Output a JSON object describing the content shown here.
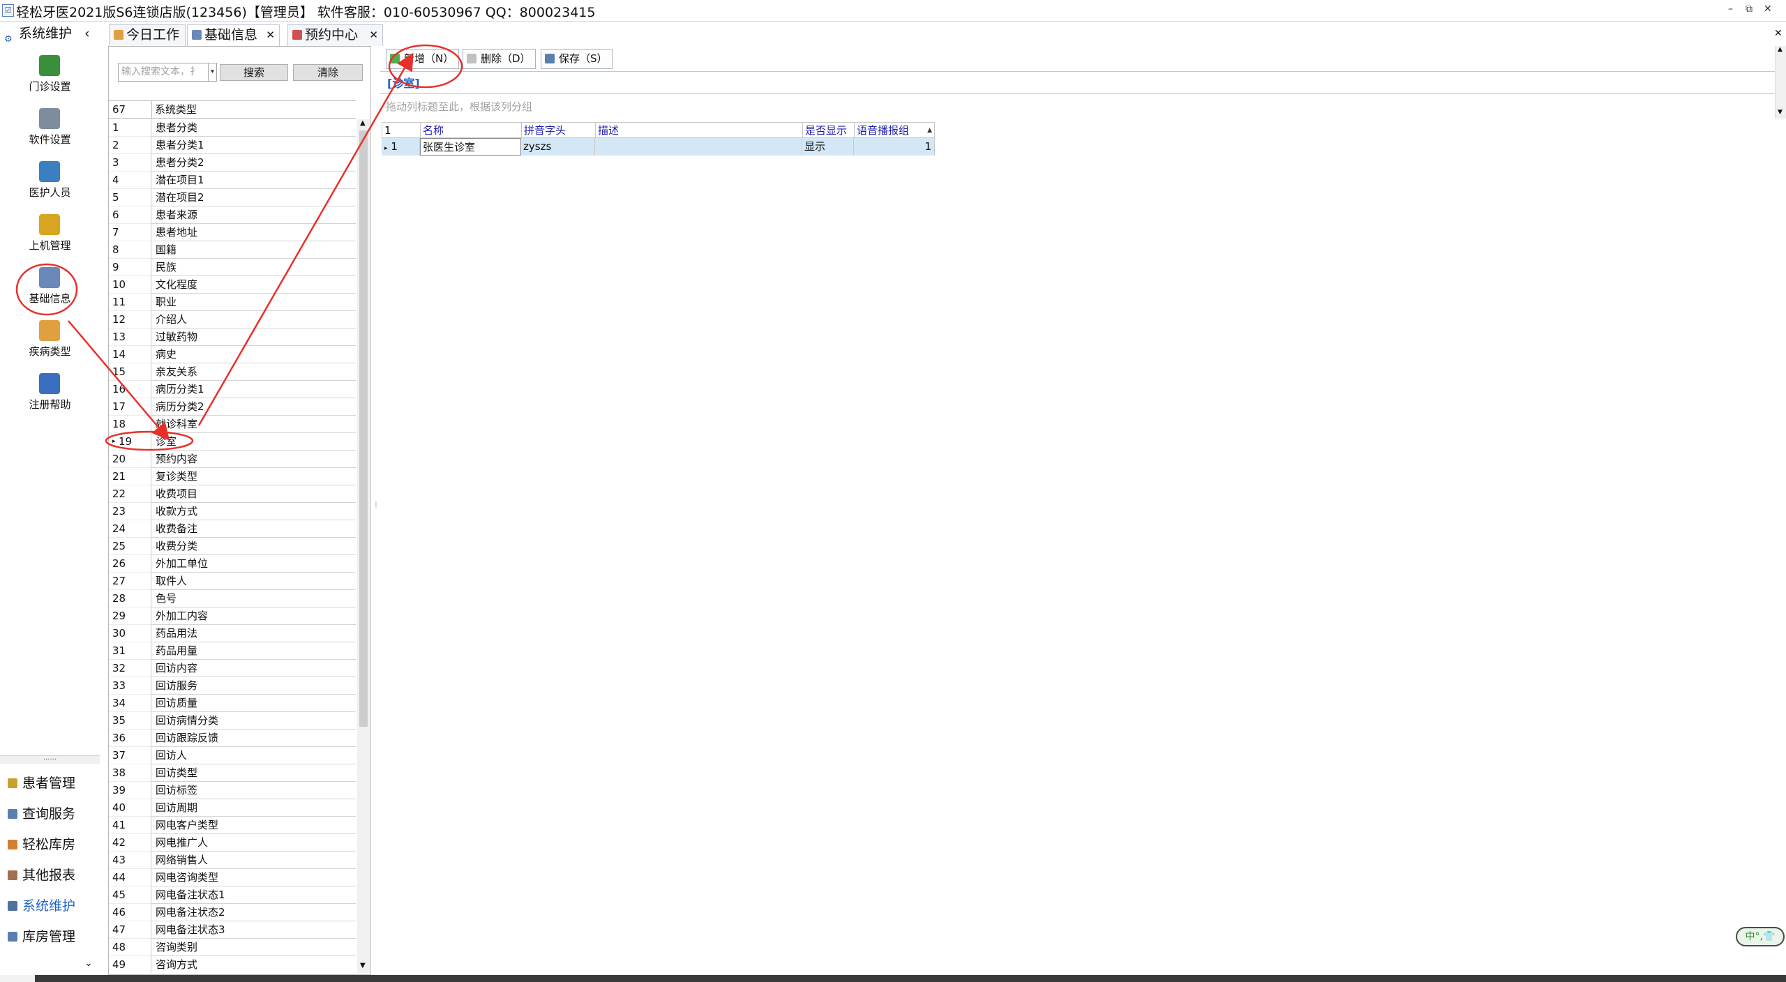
{
  "window": {
    "title": "轻松牙医2021版S6连锁店版(123456)【管理员】   软件客服：010-60530967 QQ：800023415",
    "icon": "☑",
    "controls": [
      "–",
      "⧉",
      "✕"
    ]
  },
  "tabs": [
    {
      "label": "今日工作",
      "icon": "person-icon",
      "color": "#e0a040"
    },
    {
      "label": "基础信息",
      "icon": "info-icon",
      "color": "#6a88b8",
      "close": "✕"
    },
    {
      "label": "预约中心",
      "icon": "calendar-icon",
      "color": "#d05050",
      "close": "✕"
    }
  ],
  "tab_close_all": "✕",
  "nav": {
    "header": "系统维护",
    "header_icon": "⚙",
    "collapse": "‹",
    "items": [
      {
        "label": "门诊设置",
        "icon": "home-icon",
        "color": "#3a8f3a"
      },
      {
        "label": "软件设置",
        "icon": "gears-icon",
        "color": "#7d8d9d"
      },
      {
        "label": "医护人员",
        "icon": "people-icon",
        "color": "#3a7fc0"
      },
      {
        "label": "上机管理",
        "icon": "lock-icon",
        "color": "#d9a520"
      },
      {
        "label": "基础信息",
        "icon": "info-settings-icon",
        "color": "#6a88b8"
      },
      {
        "label": "疾病类型",
        "icon": "tree-icon",
        "color": "#e0a040"
      },
      {
        "label": "注册帮助",
        "icon": "help-icon",
        "color": "#3a6fc0"
      }
    ],
    "splitter": "......",
    "modules": [
      {
        "label": "患者管理",
        "icon": "patient-icon",
        "color": "#c9a030"
      },
      {
        "label": "查询服务",
        "icon": "query-icon",
        "color": "#5a7fb0"
      },
      {
        "label": "轻松库房",
        "icon": "warehouse-icon",
        "color": "#d08030"
      },
      {
        "label": "其他报表",
        "icon": "report-icon",
        "color": "#a07050"
      },
      {
        "label": "系统维护",
        "icon": "system-icon",
        "color": "#5070a0",
        "active": true
      },
      {
        "label": "库房管理",
        "icon": "storage-icon",
        "color": "#5a7fb0"
      }
    ],
    "expand": "⌄"
  },
  "search": {
    "placeholder": "输入搜索文本，扌",
    "search_btn": "搜索",
    "clear_btn": "清除"
  },
  "type_grid": {
    "count": "67",
    "column": "系统类型",
    "rows": [
      {
        "n": "1",
        "v": "患者分类"
      },
      {
        "n": "2",
        "v": "患者分类1"
      },
      {
        "n": "3",
        "v": "患者分类2"
      },
      {
        "n": "4",
        "v": "潜在项目1"
      },
      {
        "n": "5",
        "v": "潜在项目2"
      },
      {
        "n": "6",
        "v": "患者来源"
      },
      {
        "n": "7",
        "v": "患者地址"
      },
      {
        "n": "8",
        "v": "国籍"
      },
      {
        "n": "9",
        "v": "民族"
      },
      {
        "n": "10",
        "v": "文化程度"
      },
      {
        "n": "11",
        "v": "职业"
      },
      {
        "n": "12",
        "v": "介绍人"
      },
      {
        "n": "13",
        "v": "过敏药物"
      },
      {
        "n": "14",
        "v": "病史"
      },
      {
        "n": "15",
        "v": "亲友关系"
      },
      {
        "n": "16",
        "v": "病历分类1"
      },
      {
        "n": "17",
        "v": "病历分类2"
      },
      {
        "n": "18",
        "v": "就诊科室"
      },
      {
        "n": "19",
        "v": "诊室",
        "selected": true
      },
      {
        "n": "20",
        "v": "预约内容"
      },
      {
        "n": "21",
        "v": "复诊类型"
      },
      {
        "n": "22",
        "v": "收费项目"
      },
      {
        "n": "23",
        "v": "收款方式"
      },
      {
        "n": "24",
        "v": "收费备注"
      },
      {
        "n": "25",
        "v": "收费分类"
      },
      {
        "n": "26",
        "v": "外加工单位"
      },
      {
        "n": "27",
        "v": "取件人"
      },
      {
        "n": "28",
        "v": "色号"
      },
      {
        "n": "29",
        "v": "外加工内容"
      },
      {
        "n": "30",
        "v": "药品用法"
      },
      {
        "n": "31",
        "v": "药品用量"
      },
      {
        "n": "32",
        "v": "回访内容"
      },
      {
        "n": "33",
        "v": "回访服务"
      },
      {
        "n": "34",
        "v": "回访质量"
      },
      {
        "n": "35",
        "v": "回访病情分类"
      },
      {
        "n": "36",
        "v": "回访跟踪反馈"
      },
      {
        "n": "37",
        "v": "回访人"
      },
      {
        "n": "38",
        "v": "回访类型"
      },
      {
        "n": "39",
        "v": "回访标签"
      },
      {
        "n": "40",
        "v": "回访周期"
      },
      {
        "n": "41",
        "v": "网电客户类型"
      },
      {
        "n": "42",
        "v": "网电推广人"
      },
      {
        "n": "43",
        "v": "网络销售人"
      },
      {
        "n": "44",
        "v": "网电咨询类型"
      },
      {
        "n": "45",
        "v": "网电备注状态1"
      },
      {
        "n": "46",
        "v": "网电备注状态2"
      },
      {
        "n": "47",
        "v": "网电备注状态3"
      },
      {
        "n": "48",
        "v": "咨询类别"
      },
      {
        "n": "49",
        "v": "咨询方式"
      }
    ]
  },
  "toolbar": {
    "add": "新增（N）",
    "delete": "删除（D）",
    "save": "保存（S）"
  },
  "detail": {
    "caption": "[诊室]",
    "group_hint": "拖动列标题至此，根据该列分组",
    "row_count": "1",
    "columns": [
      "名称",
      "拼音字头",
      "描述",
      "是否显示",
      "语音播报组"
    ],
    "rows": [
      {
        "marker": "▸",
        "index": "1",
        "name": "张医生诊室",
        "pinyin": "zyszs",
        "desc": "",
        "show": "显示",
        "voice": "1"
      }
    ]
  },
  "ime": "中°,👕",
  "annotation_color": "#e8302a"
}
